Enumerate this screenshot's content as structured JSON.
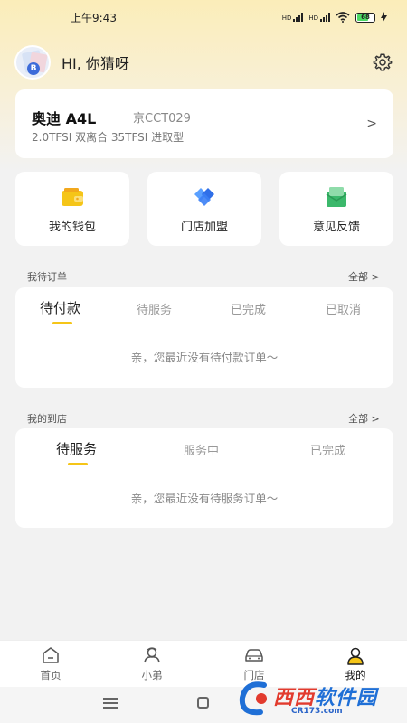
{
  "status_bar": {
    "time": "上午9:43",
    "hd1": "HD",
    "hd2": "HD",
    "battery": "68"
  },
  "header": {
    "greeting": "HI, 你猜呀",
    "avatar_badge": "B"
  },
  "car": {
    "model": "奥迪 A4L",
    "plate": "京CCT029",
    "spec": "2.0TFSI 双离合 35TFSI 进取型",
    "chevron": ">"
  },
  "features": [
    {
      "label": "我的钱包",
      "icon": "wallet-icon",
      "color": "#f5c518"
    },
    {
      "label": "门店加盟",
      "icon": "store-join-icon",
      "color": "#3b7ff5"
    },
    {
      "label": "意见反馈",
      "icon": "feedback-icon",
      "color": "#3bb86b"
    }
  ],
  "orders": {
    "title": "我待订单",
    "more": "全部 >",
    "tabs": [
      "待付款",
      "待服务",
      "已完成",
      "已取消"
    ],
    "active_tab": 0,
    "empty": "亲，您最近没有待付款订单～"
  },
  "visits": {
    "title": "我的到店",
    "more": "全部 >",
    "tabs": [
      "待服务",
      "服务中",
      "已完成"
    ],
    "active_tab": 0,
    "empty": "亲，您最近没有待服务订单～"
  },
  "bottom_nav": [
    {
      "label": "首页",
      "icon": "home-icon"
    },
    {
      "label": "小弟",
      "icon": "assistant-icon"
    },
    {
      "label": "门店",
      "icon": "car-store-icon"
    },
    {
      "label": "我的",
      "icon": "profile-icon",
      "active": true
    }
  ],
  "accent_color": "#f5c518",
  "watermark": {
    "brand_a": "西西",
    "brand_b": "软件园",
    "url": "CR173.com"
  }
}
